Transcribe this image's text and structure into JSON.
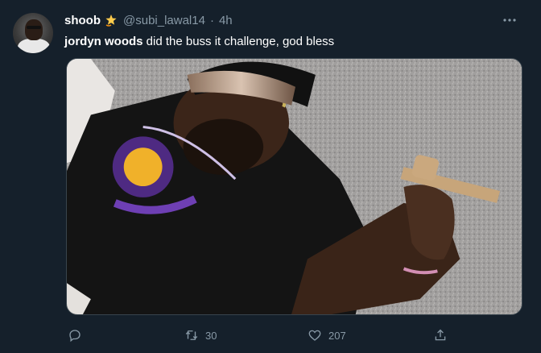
{
  "tweet": {
    "display_name": "shoob",
    "handle": "@subi_lawal14",
    "separator": "·",
    "time": "4h",
    "text_bold": "jordyn woods",
    "text_rest": " did the buss it challenge, god bless",
    "name_emoji_icon": "dizzy-star-icon",
    "more_icon": "more-horizontal-icon",
    "media_alt_icons": [
      "avatar-photo",
      "media-photo"
    ]
  },
  "actions": {
    "reply_count": "",
    "retweet_count": "30",
    "like_count": "207",
    "share_count": ""
  },
  "colors": {
    "background": "#15202b",
    "secondary_text": "#8899a6",
    "border": "#38444d"
  }
}
